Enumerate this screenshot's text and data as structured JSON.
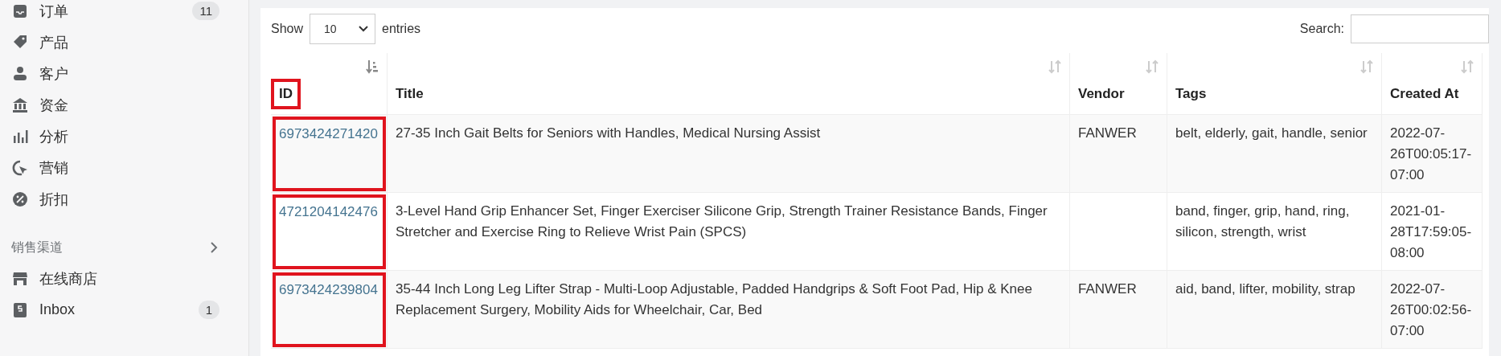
{
  "sidebar": {
    "items": [
      {
        "label": "订单",
        "badge": "11"
      },
      {
        "label": "产品"
      },
      {
        "label": "客户"
      },
      {
        "label": "资金"
      },
      {
        "label": "分析"
      },
      {
        "label": "营销"
      },
      {
        "label": "折扣"
      }
    ],
    "sections": [
      {
        "title": "销售渠道",
        "items": [
          {
            "label": "在线商店"
          },
          {
            "label": "Inbox",
            "badge": "1"
          }
        ]
      }
    ]
  },
  "length_menu": {
    "before": "Show",
    "value": "10",
    "after": "entries"
  },
  "search": {
    "label": "Search:"
  },
  "table": {
    "columns": [
      {
        "label": "ID",
        "sorted": true,
        "highlighted": true
      },
      {
        "label": "Title",
        "sorted": false,
        "highlighted": false
      },
      {
        "label": "Vendor",
        "sorted": false,
        "highlighted": false
      },
      {
        "label": "Tags",
        "sorted": false,
        "highlighted": false
      },
      {
        "label": "Created At",
        "sorted": false,
        "highlighted": false
      }
    ],
    "rows": [
      {
        "id": "6973424271420",
        "highlighted": true,
        "title": "27-35 Inch Gait Belts for Seniors with Handles, Medical Nursing Assist",
        "vendor": "FANWER",
        "tags": "belt, elderly, gait, handle, senior",
        "created": "2022-07-26T00:05:17-07:00"
      },
      {
        "id": "4721204142476",
        "highlighted": true,
        "title": "3-Level Hand Grip Enhancer Set, Finger Exerciser Silicone Grip, Strength Trainer Resistance Bands, Finger Stretcher and Exercise Ring to Relieve Wrist Pain (SPCS)",
        "tags": "band, finger, grip, hand, ring, silicon, strength, wrist",
        "created": "2021-01-28T17:59:05-08:00"
      },
      {
        "id": "6973424239804",
        "highlighted": true,
        "title": "35-44 Inch Long Leg Lifter Strap - Multi-Loop Adjustable, Padded Handgrips & Soft Foot Pad, Hip & Knee Replacement Surgery, Mobility Aids for Wheelchair, Car, Bed",
        "vendor": "FANWER",
        "tags": "aid, band, lifter, mobility, strap",
        "created": "2022-07-26T00:02:56-07:00"
      }
    ]
  }
}
